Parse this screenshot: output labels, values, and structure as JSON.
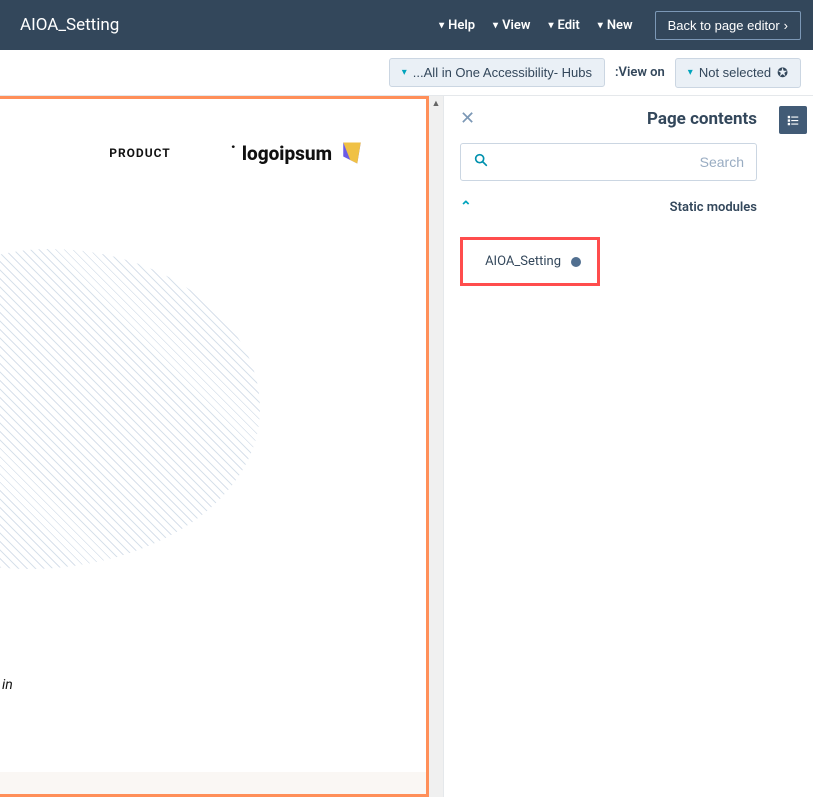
{
  "topbar": {
    "back": "Back to page editor",
    "menu": {
      "new": "New",
      "edit": "Edit",
      "view": "View",
      "help": "Help"
    },
    "title": "AIOA_Setting"
  },
  "subbar": {
    "not_selected": "Not selected",
    "view_on": "View on:",
    "device": "All in One Accessibility- Hubs..."
  },
  "panel": {
    "title": "Page contents",
    "search_ph": "Search",
    "section": "Static modules",
    "module1": "AIOA_Setting"
  },
  "preview": {
    "logo": "logoipsum",
    "nav_product": "PRODUCT",
    "hero_in": "in"
  }
}
